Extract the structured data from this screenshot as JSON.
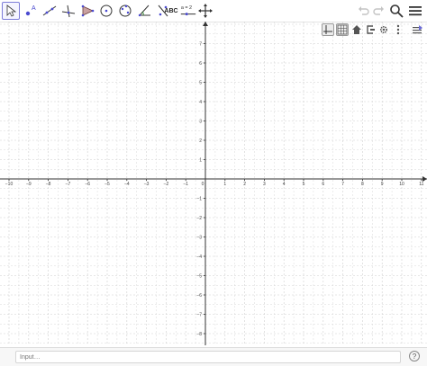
{
  "toolbar": {
    "tools": [
      {
        "name": "move-tool",
        "icon": "cursor-arrow-icon"
      },
      {
        "name": "point-tool",
        "icon": "point-icon",
        "label": "A"
      },
      {
        "name": "line-tool",
        "icon": "line-icon"
      },
      {
        "name": "perpendicular-tool",
        "icon": "perpendicular-line-icon"
      },
      {
        "name": "polygon-tool",
        "icon": "polygon-icon"
      },
      {
        "name": "circle-tool",
        "icon": "circle-center-point-icon"
      },
      {
        "name": "ellipse-tool",
        "icon": "ellipse-icon"
      },
      {
        "name": "angle-tool",
        "icon": "angle-icon"
      },
      {
        "name": "reflect-tool",
        "icon": "reflect-icon"
      },
      {
        "name": "text-tool",
        "icon": "text-icon",
        "label": "ABC"
      },
      {
        "name": "slider-tool",
        "icon": "slider-icon",
        "label": "a = 2"
      },
      {
        "name": "move-graphics-tool",
        "icon": "move-graphics-view-icon"
      }
    ],
    "right": [
      "undo-icon",
      "redo-icon",
      "search-icon",
      "menu-icon"
    ]
  },
  "style_bar": [
    "axes-toggle-icon",
    "grid-toggle-icon",
    "home-icon",
    "zoom-to-fit-icon",
    "settings-icon",
    "more-options-icon",
    "toggle-style-bar-icon"
  ],
  "graph": {
    "x_ticks": [
      "−10",
      "−9",
      "−8",
      "−7",
      "−6",
      "−5",
      "−4",
      "−3",
      "−2",
      "−1",
      "0",
      "1",
      "2",
      "3",
      "4",
      "5",
      "6",
      "7",
      "8",
      "9",
      "10",
      "11"
    ],
    "y_ticks_positive": [
      "7",
      "6",
      "5",
      "4",
      "3",
      "2",
      "1"
    ],
    "y_ticks_negative": [
      "−1",
      "−2",
      "−3",
      "−4",
      "−5",
      "−6",
      "−7",
      "−8"
    ]
  },
  "input": {
    "placeholder": "Input…"
  },
  "colors": {
    "accent": "#7c7cd8",
    "grid": "#cfcfcf",
    "axis": "#333333"
  }
}
